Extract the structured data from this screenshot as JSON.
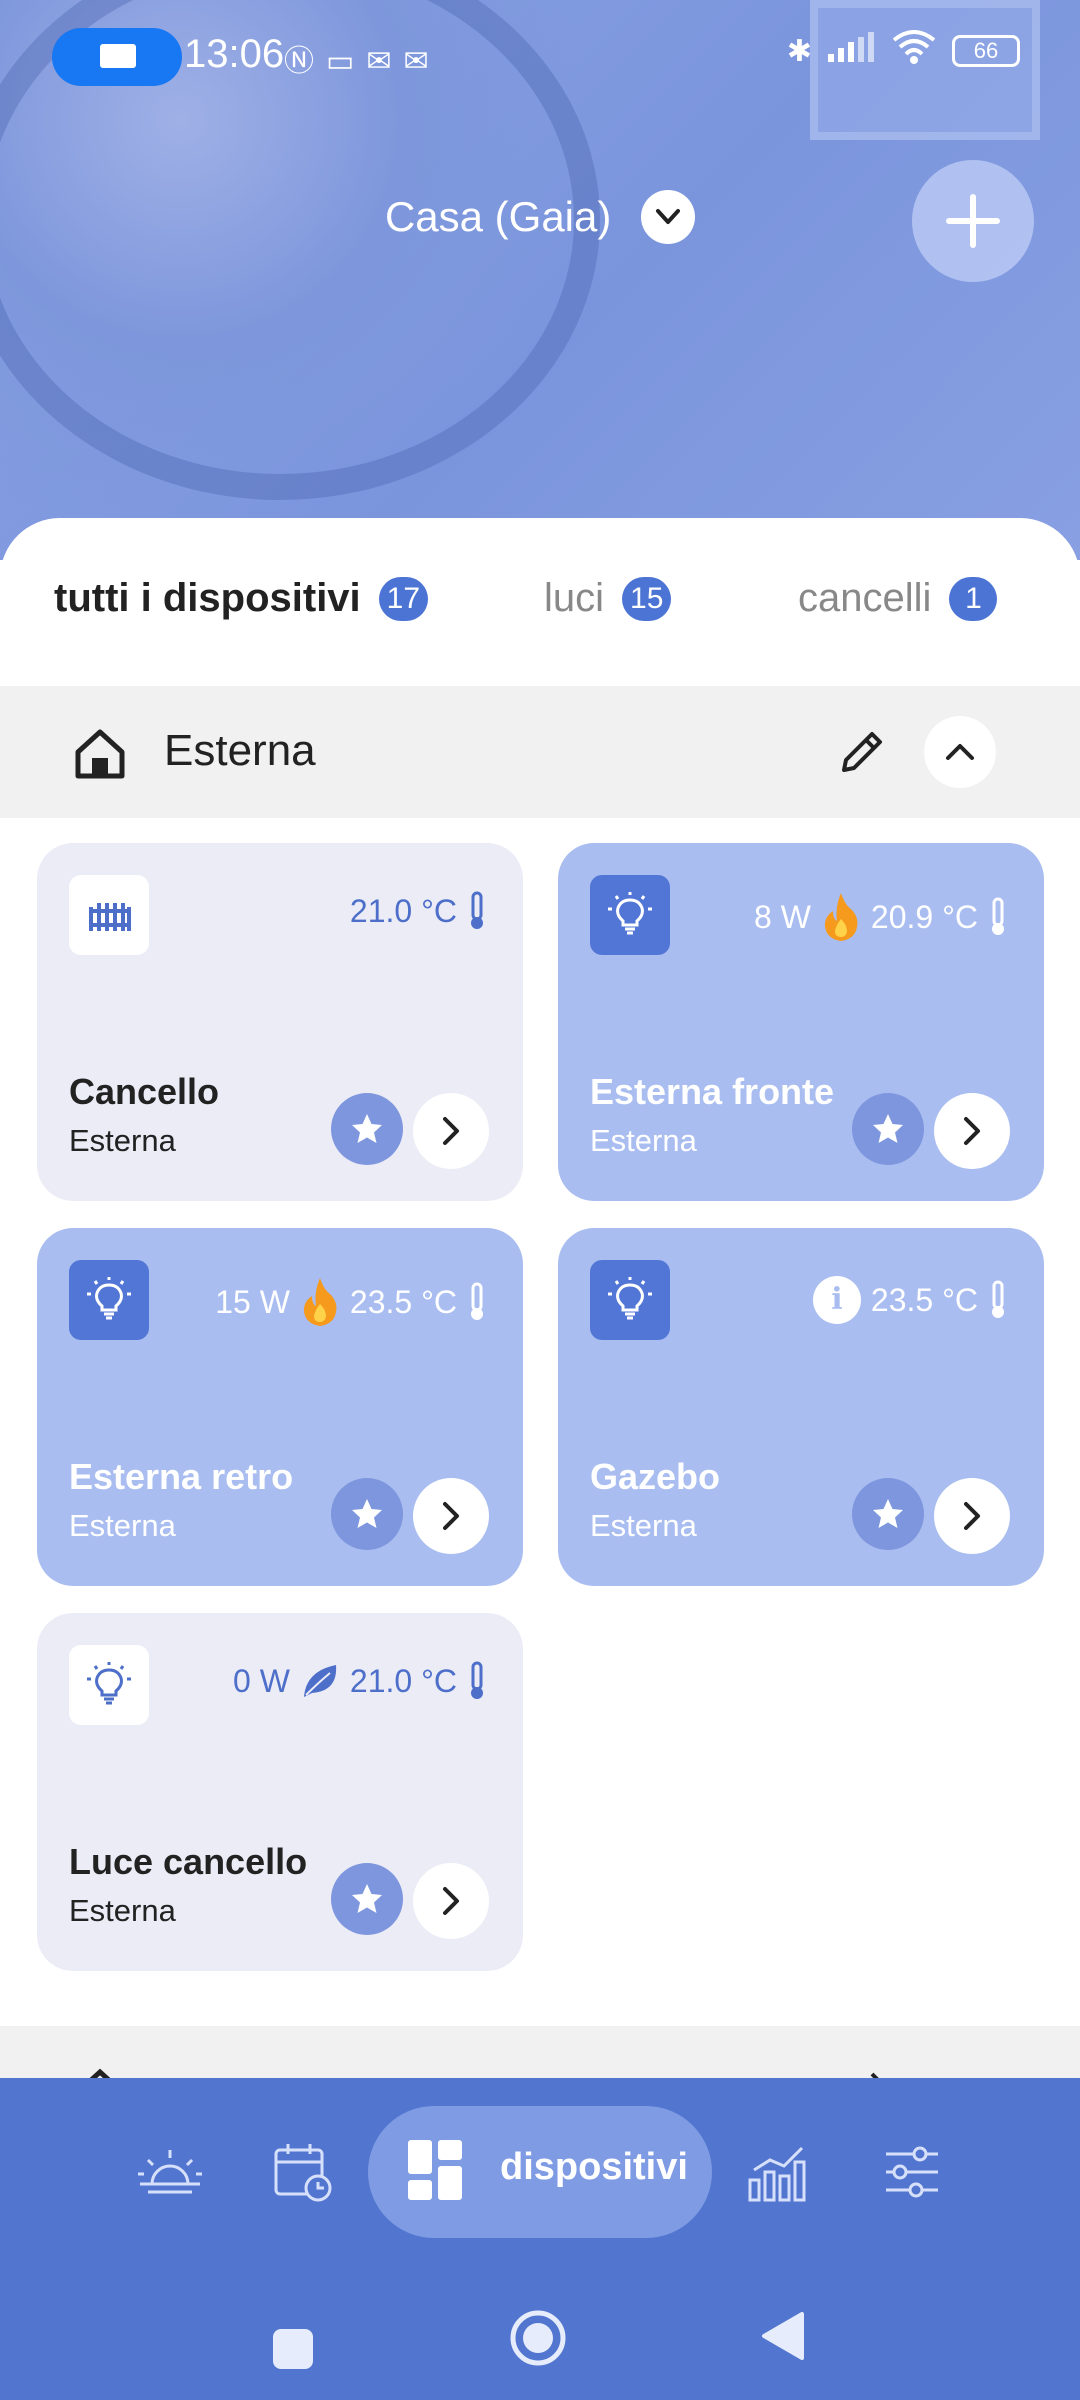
{
  "status_bar": {
    "time": "13:06",
    "battery": "66",
    "notification_icons": [
      "nfc-icon",
      "screen-icon",
      "mail-icon",
      "mail-icon"
    ]
  },
  "header": {
    "home_name": "Casa (Gaia)"
  },
  "tabs": [
    {
      "label": "tutti i dispositivi",
      "count": "17",
      "active": true
    },
    {
      "label": "luci",
      "count": "15",
      "active": false
    },
    {
      "label": "cancelli",
      "count": "1",
      "active": false
    }
  ],
  "section": {
    "title": "Esterna"
  },
  "devices": [
    {
      "name": "Cancello",
      "room": "Esterna",
      "power": "",
      "temperature": "21.0 °C",
      "icon": "gate-icon",
      "style": "light"
    },
    {
      "name": "Esterna fronte",
      "room": "Esterna",
      "power": "8 W",
      "temperature": "20.9 °C",
      "icon": "bulb-icon",
      "style": "blue",
      "power_state": "fire-icon"
    },
    {
      "name": "Esterna retro",
      "room": "Esterna",
      "power": "15 W",
      "temperature": "23.5 °C",
      "icon": "bulb-icon",
      "style": "blue",
      "power_state": "fire-icon"
    },
    {
      "name": "Gazebo",
      "room": "Esterna",
      "power": "",
      "temperature": "23.5 °C",
      "icon": "bulb-icon",
      "style": "blue",
      "info": "i"
    },
    {
      "name": "Luce cancello",
      "room": "Esterna",
      "power": "0 W",
      "temperature": "21.0 °C",
      "icon": "bulb-icon",
      "style": "light",
      "power_state": "leaf-icon"
    }
  ],
  "bottom_nav": {
    "active_label": "dispositivi",
    "items": [
      "sunrise-icon",
      "calendar-icon",
      "dashboard-icon",
      "chart-icon",
      "sliders-icon"
    ]
  },
  "colors": {
    "accent": "#5276cf",
    "card_blue": "#a9bdf0",
    "card_light": "#ececf7",
    "flame": "#f59a1c"
  }
}
